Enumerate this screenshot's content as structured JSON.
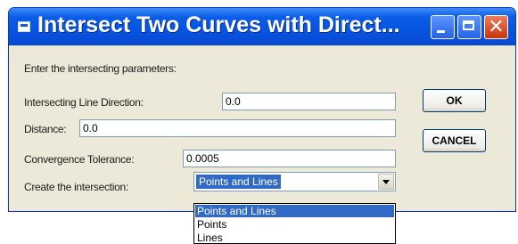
{
  "window": {
    "title": "Intersect Two Curves with Direct..."
  },
  "form": {
    "heading": "Enter the intersecting parameters:",
    "direction_label": "Intersecting Line Direction:",
    "direction_value": "0.0",
    "distance_label": "Distance:",
    "distance_value": "0.0",
    "tolerance_label": "Convergence Tolerance:",
    "tolerance_value": "0.0005",
    "create_label": "Create the intersection:",
    "create_selected": "Points and Lines",
    "create_options": [
      "Points and Lines",
      "Points",
      "Lines"
    ]
  },
  "buttons": {
    "ok": "OK",
    "cancel": "CANCEL"
  },
  "icons": {
    "system": "app-icon",
    "minimize": "minimize-icon",
    "maximize": "maximize-icon",
    "close": "close-icon",
    "dropdown": "chevron-down-icon"
  },
  "colors": {
    "titlebar": "#0654e0",
    "dialog_bg": "#ece9d8",
    "selection": "#316ac5",
    "close_button": "#c8340d"
  }
}
